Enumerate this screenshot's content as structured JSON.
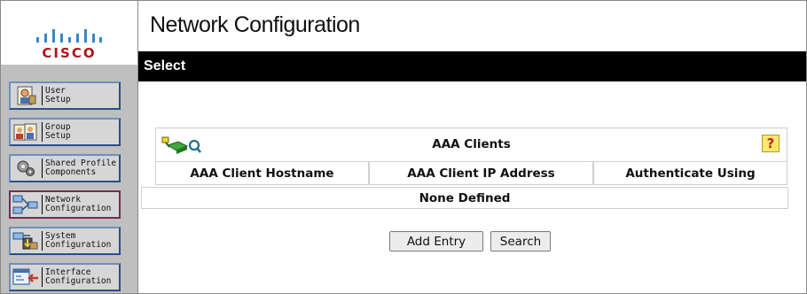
{
  "brand": {
    "logo_text": "CISCO"
  },
  "sidebar": {
    "items": [
      {
        "label": "User\nSetup",
        "icon": "user-setup-icon"
      },
      {
        "label": "Group\nSetup",
        "icon": "group-setup-icon"
      },
      {
        "label": "Shared Profile\nComponents",
        "icon": "shared-profile-icon"
      },
      {
        "label": "Network\nConfiguration",
        "icon": "network-config-icon"
      },
      {
        "label": "System\nConfiguration",
        "icon": "system-config-icon"
      },
      {
        "label": "Interface\nConfiguration",
        "icon": "interface-config-icon"
      }
    ],
    "active_index": 3
  },
  "page": {
    "title": "Network Configuration",
    "section": "Select"
  },
  "clients": {
    "title": "AAA Clients",
    "help_glyph": "?",
    "columns": [
      "AAA Client Hostname",
      "AAA Client IP Address",
      "Authenticate Using"
    ],
    "empty_text": "None Defined"
  },
  "actions": {
    "add_label": "Add Entry",
    "search_label": "Search"
  },
  "colors": {
    "select_bar": "#000000",
    "sidebar_bg": "#bfbfbf",
    "nav_border": "#2b4f86",
    "active_border": "#7a2b54",
    "cisco_red": "#b0131d",
    "help_bg": "#ffe86a"
  }
}
